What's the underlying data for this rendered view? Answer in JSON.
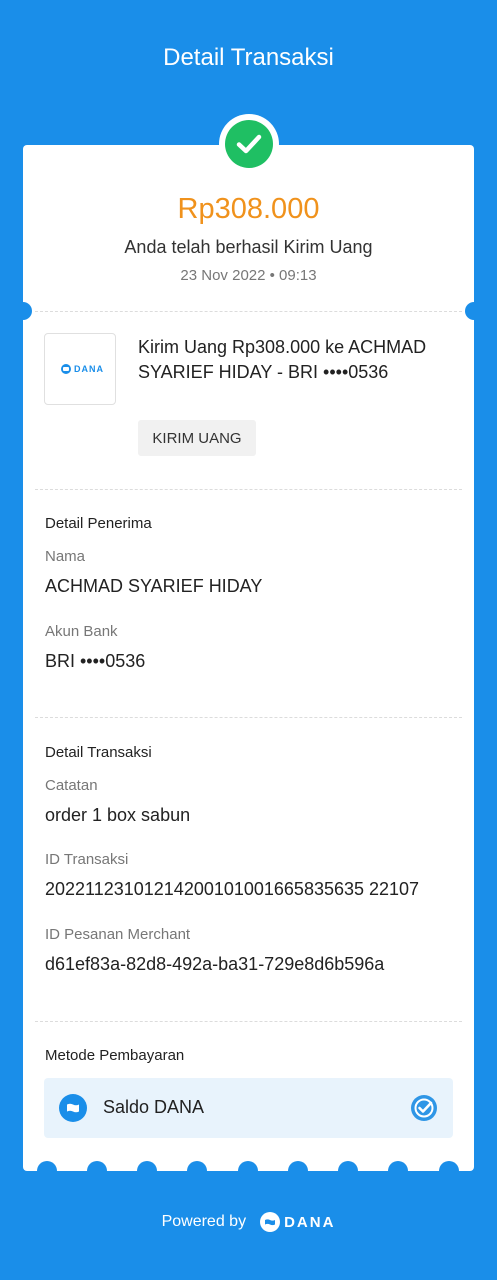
{
  "header": {
    "title": "Detail Transaksi"
  },
  "summary": {
    "amount": "Rp308.000",
    "status": "Anda telah berhasil Kirim Uang",
    "datetime": "23 Nov 2022 • 09:13"
  },
  "transaction": {
    "logo_text": "DANA",
    "description": "Kirim Uang Rp308.000 ke ACHMAD SYARIEF HIDAY - BRI ••••0536",
    "tag": "KIRIM UANG"
  },
  "recipient": {
    "title": "Detail Penerima",
    "name_label": "Nama",
    "name_value": "ACHMAD SYARIEF HIDAY",
    "bank_label": "Akun Bank",
    "bank_value": "BRI ••••0536"
  },
  "details": {
    "title": "Detail Transaksi",
    "note_label": "Catatan",
    "note_value": "order 1 box sabun",
    "id_label": "ID Transaksi",
    "id_value": "20221123101214200101001665835635 22107",
    "merchant_label": "ID Pesanan Merchant",
    "merchant_value": "d61ef83a-82d8-492a-ba31-729e8d6b596a"
  },
  "payment": {
    "title": "Metode Pembayaran",
    "method": "Saldo DANA",
    "icon": "wallet-icon",
    "selected_icon": "check-badge-icon"
  },
  "footer": {
    "powered_by": "Powered by",
    "brand": "DANA"
  },
  "colors": {
    "primary": "#1a8ee9",
    "amount": "#f0921c",
    "success": "#1fbf63"
  }
}
